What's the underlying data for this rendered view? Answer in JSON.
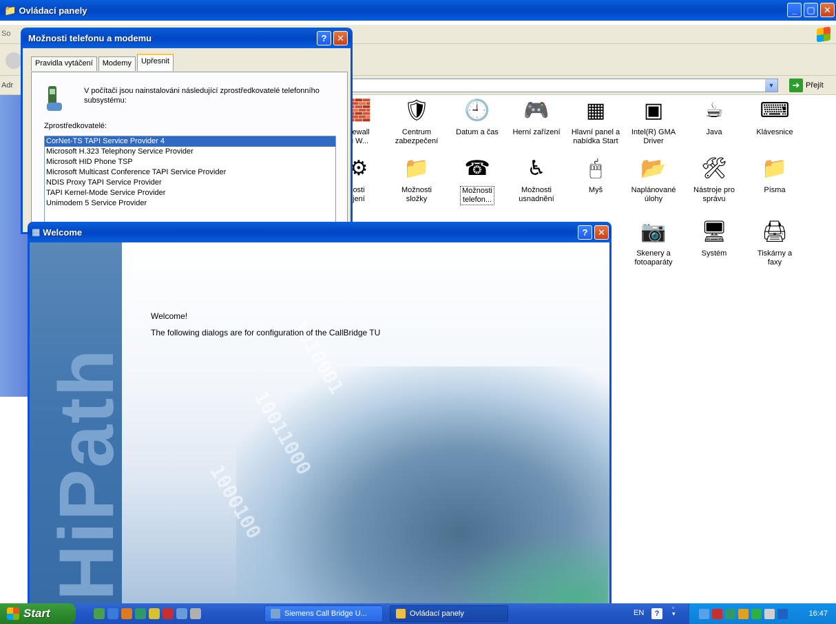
{
  "control_panel": {
    "title": "Ovládací panely",
    "address_label": "Adr",
    "menubar_partial": "So",
    "go_label": "Přejít",
    "icons": [
      {
        "label": "irewall\nu W...",
        "icon": "firewall-icon",
        "glyph": "🧱"
      },
      {
        "label": "Centrum\nzabezpečení",
        "icon": "security-center-icon",
        "glyph": "🛡"
      },
      {
        "label": "Datum a čas",
        "icon": "date-time-icon",
        "glyph": "🕘"
      },
      {
        "label": "Herní zařízení",
        "icon": "game-controller-icon",
        "glyph": "🎮"
      },
      {
        "label": "Hlavní panel a\nnabídka Start",
        "icon": "taskbar-start-icon",
        "glyph": "▦"
      },
      {
        "label": "Intel(R) GMA\nDriver",
        "icon": "intel-gma-icon",
        "glyph": "▣"
      },
      {
        "label": "Java",
        "icon": "java-icon",
        "glyph": "☕"
      },
      {
        "label": "Klávesnice",
        "icon": "keyboard-icon",
        "glyph": "⌨"
      },
      {
        "label": "osti\njení",
        "icon": "options-partial-icon",
        "glyph": "⚙"
      },
      {
        "label": "Možnosti\nsložky",
        "icon": "folder-options-icon",
        "glyph": "📁"
      },
      {
        "label": "Možnosti\ntelefon...",
        "icon": "phone-modem-icon",
        "glyph": "☎"
      },
      {
        "label": "Možnosti\nusnadnění",
        "icon": "accessibility-icon",
        "glyph": "♿"
      },
      {
        "label": "Myš",
        "icon": "mouse-icon",
        "glyph": "🖱"
      },
      {
        "label": "Naplánované\núlohy",
        "icon": "scheduled-tasks-icon",
        "glyph": "📂"
      },
      {
        "label": "Nástroje pro\nsprávu",
        "icon": "admin-tools-icon",
        "glyph": "🛠"
      },
      {
        "label": "Písma",
        "icon": "fonts-icon",
        "glyph": "📁"
      },
      {
        "label": "Skenery a\nfotoaparáty",
        "icon": "scanner-camera-icon",
        "glyph": "📷"
      },
      {
        "label": "Systém",
        "icon": "system-icon",
        "glyph": "🖥"
      },
      {
        "label": "Tiskárny a\nfaxy",
        "icon": "printers-faxes-icon",
        "glyph": "🖨"
      }
    ]
  },
  "modem_dialog": {
    "title": "Možnosti telefonu a modemu",
    "tabs": [
      "Pravidla vytáčení",
      "Modemy",
      "Upřesnit"
    ],
    "active_tab": "Upřesnit",
    "intro": "V počítači jsou nainstalováni následující zprostředkovatelé telefonního subsystému:",
    "providers_label": "Zprostředkovatelé:",
    "providers": [
      "CorNet-TS TAPI Service Provider 4",
      "Microsoft H.323 Telephony Service Provider",
      "Microsoft HID Phone TSP",
      "Microsoft Multicast Conference TAPI Service Provider",
      "NDIS Proxy TAPI Service Provider",
      "TAPI Kernel-Mode Service Provider",
      "Unimodem 5 Service Provider"
    ],
    "selected_provider": "CorNet-TS TAPI Service Provider 4"
  },
  "welcome_dialog": {
    "title": "Welcome",
    "heading": "Welcome!",
    "text": "The following dialogs are for configuration of the  CallBridge TU",
    "sidebar_word": "HiPath"
  },
  "title_buttons": {
    "help": "?",
    "close": "✕",
    "minimize": "_",
    "maximize": "▢"
  },
  "taskbar": {
    "start_label": "Start",
    "tasks": [
      {
        "label": "Siemens Call Bridge U...",
        "active": false
      },
      {
        "label": "Ovládací panely",
        "active": true
      }
    ],
    "language": "EN",
    "clock": "16:47"
  },
  "colors": {
    "xp_blue": "#0a53d6",
    "selection": "#316ac5",
    "start_green": "#2e8b2e"
  }
}
